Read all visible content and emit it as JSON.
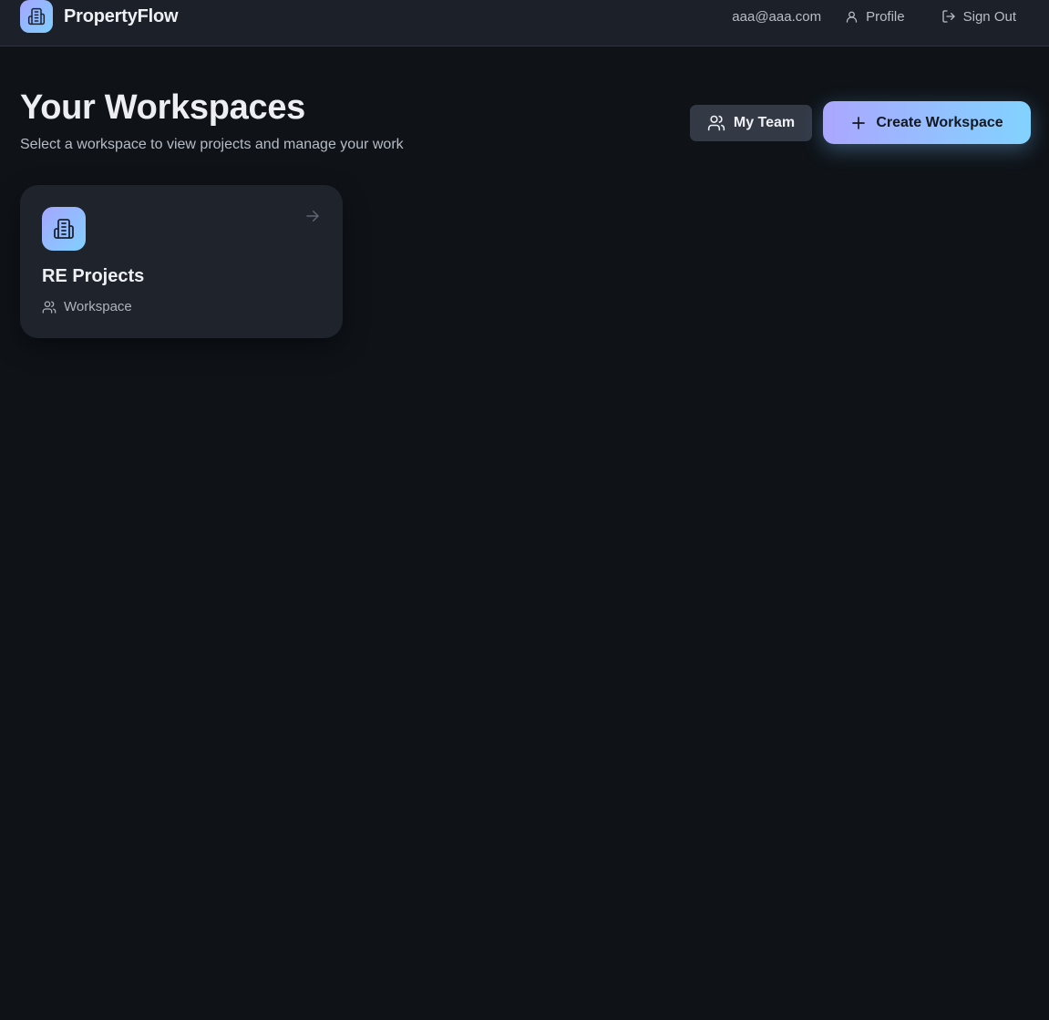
{
  "header": {
    "brand_name": "PropertyFlow",
    "brand_icon": "building-icon",
    "user_email": "aaa@aaa.com",
    "profile_label": "Profile",
    "sign_out_label": "Sign Out"
  },
  "main": {
    "title": "Your Workspaces",
    "subtitle": "Select a workspace to view projects and manage your work",
    "actions": {
      "my_team_label": "My Team",
      "create_workspace_label": "Create Workspace"
    },
    "workspaces": [
      {
        "name": "RE Projects",
        "type_label": "Workspace",
        "icon": "building-icon"
      }
    ]
  },
  "colors": {
    "background": "#0f1318",
    "header_bg": "#1b2029",
    "card_bg": "#1e232c",
    "accent_gradient_start": "#aba6ff",
    "accent_gradient_end": "#82d2ff",
    "secondary_button_bg": "#333a46"
  }
}
